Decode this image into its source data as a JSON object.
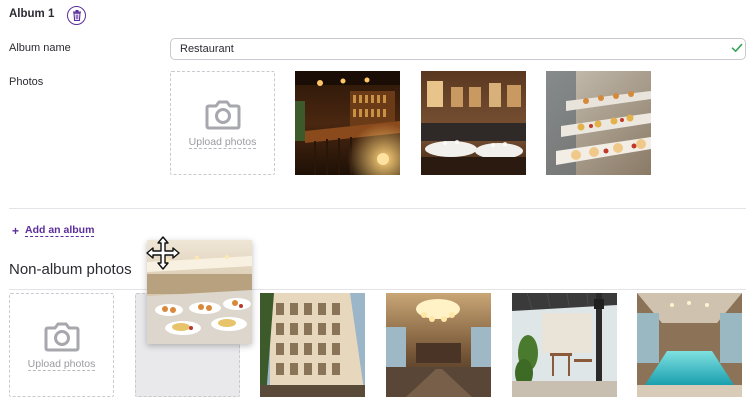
{
  "album": {
    "title": "Album 1",
    "name_label": "Album name",
    "name_value": "Restaurant",
    "photos_label": "Photos",
    "upload_label": "Upload photos",
    "photos": [
      {
        "name": "restaurant-bar-photo"
      },
      {
        "name": "restaurant-dining-photo"
      },
      {
        "name": "dessert-buffet-photo"
      }
    ]
  },
  "add_album_label": "Add an album",
  "non_album": {
    "title": "Non-album photos",
    "upload_label": "Upload photos",
    "photos": [
      {
        "name": "hotel-building-photo"
      },
      {
        "name": "hotel-lobby-photo"
      },
      {
        "name": "terrace-photo"
      },
      {
        "name": "indoor-pool-photo"
      }
    ],
    "dragging_photo": "buffet-photo"
  },
  "colors": {
    "accent": "#5b2d9c",
    "valid": "#3aa35a",
    "border": "#c9c9cf",
    "muted_text": "#9a9aa2"
  },
  "icons": [
    "trash-icon",
    "check-icon",
    "camera-icon",
    "plus-icon",
    "move-cursor-icon"
  ]
}
